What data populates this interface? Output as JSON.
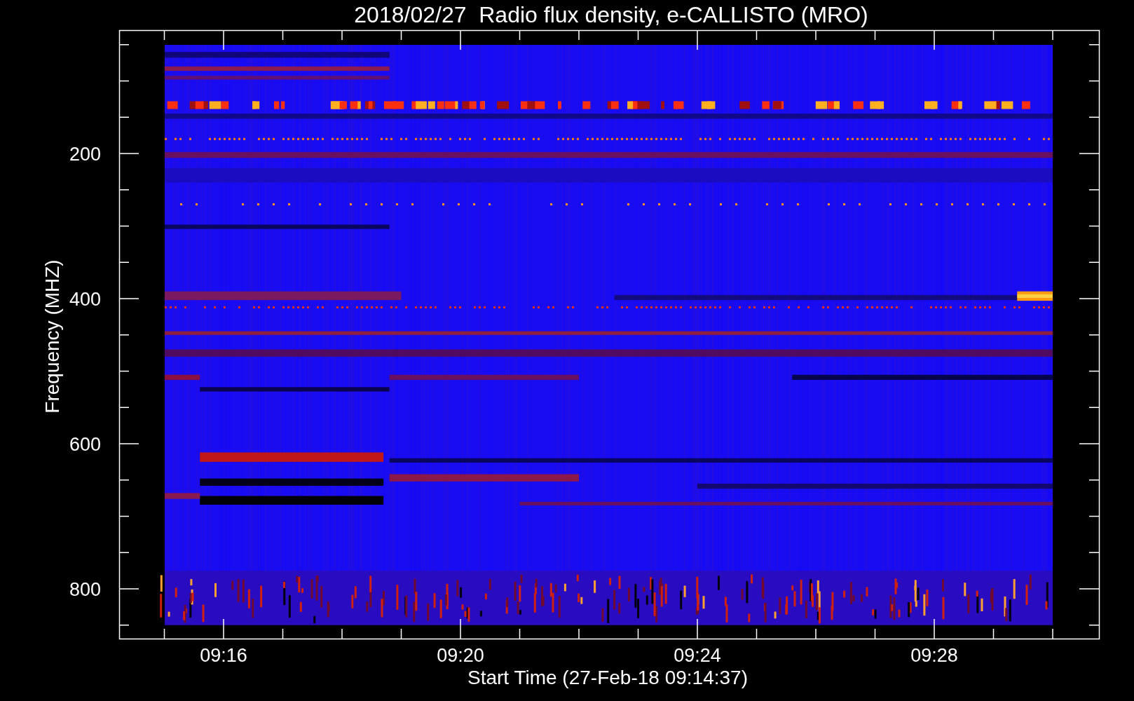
{
  "title": "2018/02/27  Radio flux density, e-CALLISTO (MRO)",
  "y_axis": {
    "label": "Frequency (MHZ)",
    "tick_labels": [
      "200",
      "400",
      "600",
      "800"
    ]
  },
  "x_axis": {
    "label": "Start Time (27-Feb-18 09:14:37)",
    "tick_labels": [
      "09:16",
      "09:20",
      "09:24",
      "09:28"
    ]
  }
}
